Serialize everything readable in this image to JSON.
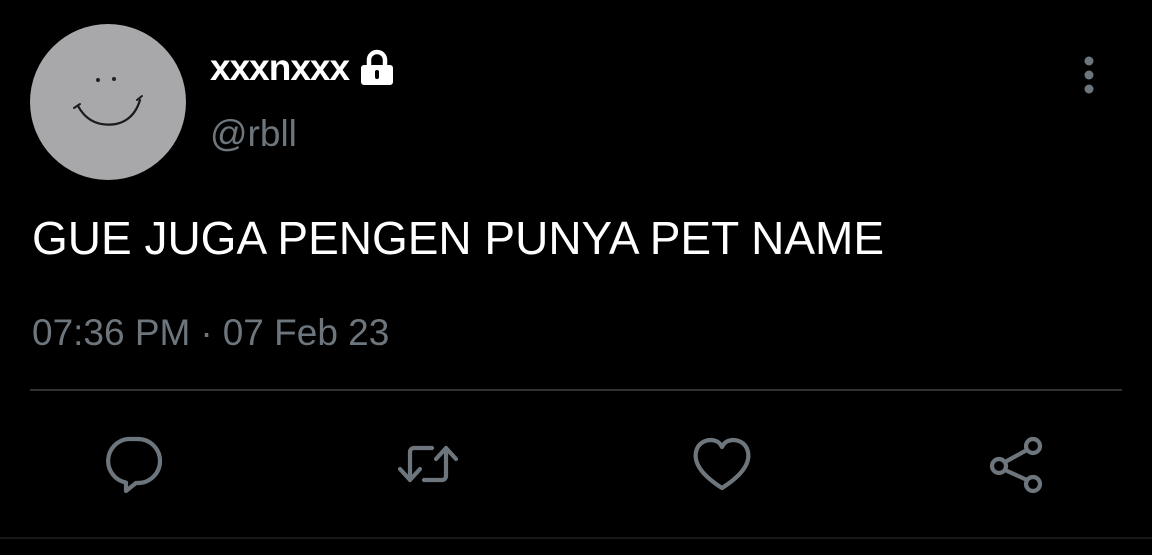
{
  "tweet": {
    "author": {
      "display_name": "xxxnxxx",
      "handle": "@rbll",
      "protected_icon": "lock-icon",
      "avatar_icon": "smiley-face-icon"
    },
    "text": "GUE JUGA PENGEN PUNYA PET NAME",
    "time": "07:36 PM",
    "separator": "·",
    "date": "07 Feb 23",
    "more_icon": "more-vertical-icon"
  },
  "actions": [
    {
      "name": "reply",
      "icon": "reply-icon"
    },
    {
      "name": "retweet",
      "icon": "retweet-icon"
    },
    {
      "name": "like",
      "icon": "heart-icon"
    },
    {
      "name": "share",
      "icon": "share-icon"
    }
  ],
  "colors": {
    "background": "#000000",
    "text_primary": "#ffffff",
    "text_secondary": "#6e767d",
    "avatar_bg": "#a8a7a9",
    "divider": "#2f3336",
    "icon": "#6e767d"
  }
}
